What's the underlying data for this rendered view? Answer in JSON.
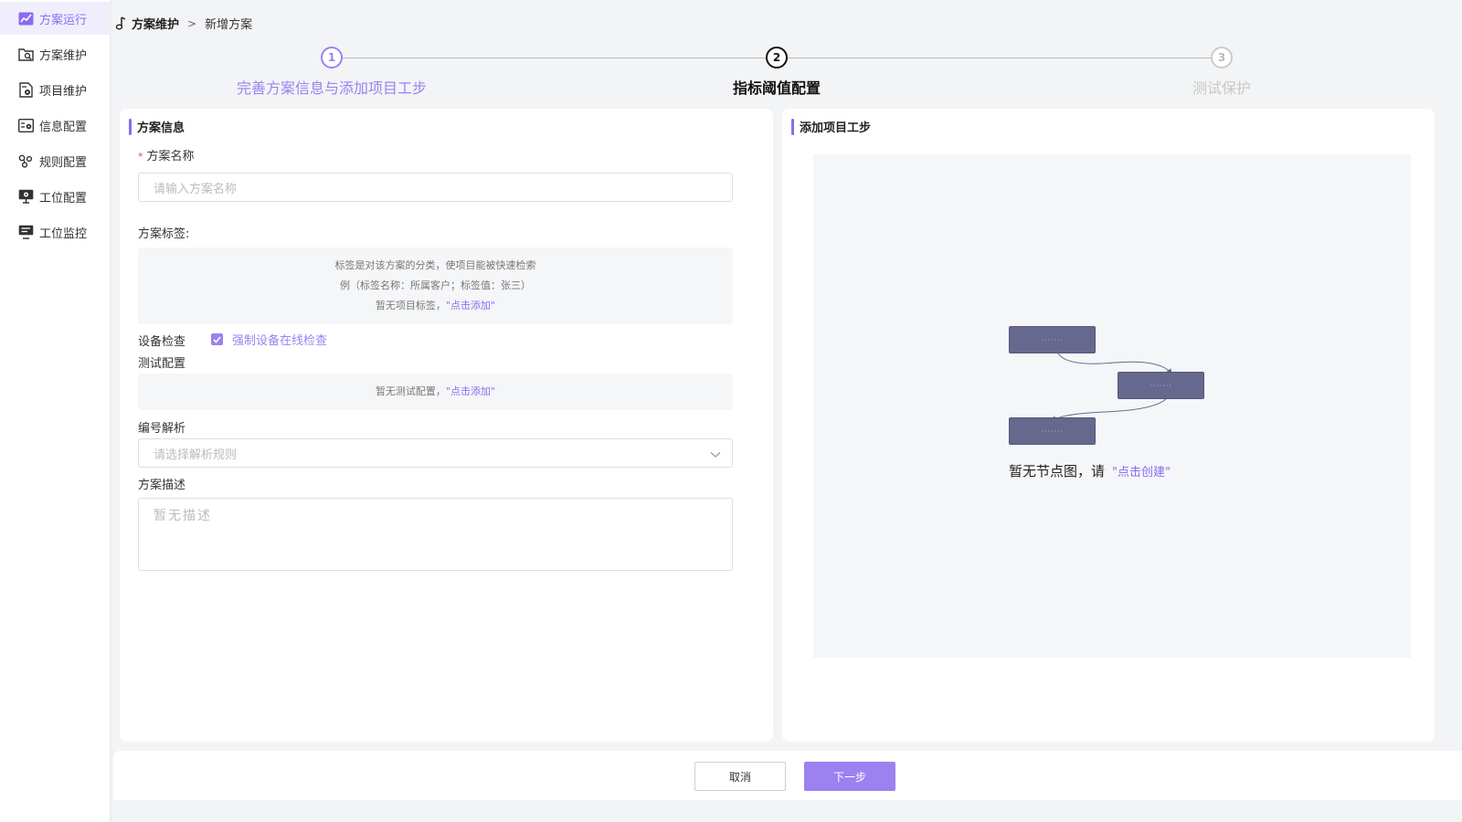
{
  "sidebar": {
    "items": [
      {
        "label": "方案运行",
        "icon": "chart-line-icon",
        "active": true
      },
      {
        "label": "方案维护",
        "icon": "folder-search-icon",
        "active": false
      },
      {
        "label": "项目维护",
        "icon": "document-gear-icon",
        "active": false
      },
      {
        "label": "信息配置",
        "icon": "id-card-gear-icon",
        "active": false
      },
      {
        "label": "规则配置",
        "icon": "nodes-icon",
        "active": false
      },
      {
        "label": "工位配置",
        "icon": "monitor-gear-icon",
        "active": false
      },
      {
        "label": "工位监控",
        "icon": "monitor-list-icon",
        "active": false
      }
    ]
  },
  "breadcrumb": {
    "root": "方案维护",
    "separator": ">",
    "current": "新增方案"
  },
  "steps": [
    {
      "num": "1",
      "label": "完善方案信息与添加项目工步",
      "state": "done"
    },
    {
      "num": "2",
      "label": "指标阈值配置",
      "state": "current"
    },
    {
      "num": "3",
      "label": "测试保护",
      "state": "todo"
    }
  ],
  "left_panel": {
    "title": "方案信息",
    "name_label": "方案名称",
    "name_required": "*",
    "name_placeholder": "请输入方案名称",
    "tags_label": "方案标签:",
    "tags_hint_1": "标签是对该方案的分类，使项目能被快速检索",
    "tags_hint_2": "例（标签名称：所属客户；标签值：张三）",
    "tags_empty": "暂无项目标签，",
    "tags_add": "\"点击添加\"",
    "device_check_label": "设备检查",
    "device_check_option": "强制设备在线检查",
    "device_check_checked": true,
    "test_config_label": "测试配置",
    "test_config_empty": "暂无测试配置，",
    "test_config_add": "\"点击添加\"",
    "parse_label": "编号解析",
    "parse_placeholder": "请选择解析规则",
    "desc_label": "方案描述",
    "desc_placeholder": "暂无描述"
  },
  "right_panel": {
    "title": "添加项目工步",
    "node_text": "·······",
    "empty_text": "暂无节点图，请",
    "empty_link": "\"点击创建\""
  },
  "footer": {
    "cancel_label": "取消",
    "next_label": "下一步"
  },
  "colors": {
    "accent": "#9b82f0",
    "node": "#67688e",
    "required": "#e34d4d"
  }
}
